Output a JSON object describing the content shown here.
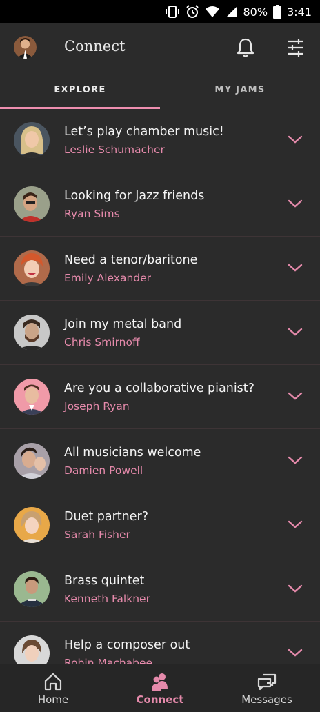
{
  "status": {
    "battery": "80%",
    "time": "3:41"
  },
  "header": {
    "title": "Connect"
  },
  "tabs": [
    {
      "label": "EXPLORE"
    },
    {
      "label": "MY JAMS"
    }
  ],
  "colors": {
    "accent": "#ee8fb0",
    "background": "#2b2b2b"
  },
  "jams": [
    {
      "title": "Let’s play chamber music!",
      "name": "Leslie Schumacher"
    },
    {
      "title": "Looking for Jazz friends",
      "name": "Ryan Sims"
    },
    {
      "title": "Need a tenor/baritone",
      "name": "Emily Alexander"
    },
    {
      "title": "Join my metal band",
      "name": "Chris Smirnoff"
    },
    {
      "title": "Are you a collaborative pianist?",
      "name": "Joseph Ryan"
    },
    {
      "title": "All musicians welcome",
      "name": "Damien Powell"
    },
    {
      "title": "Duet partner?",
      "name": "Sarah Fisher"
    },
    {
      "title": "Brass quintet",
      "name": "Kenneth Falkner"
    },
    {
      "title": "Help a composer out",
      "name": "Robin Machabee"
    }
  ],
  "nav": [
    {
      "label": "Home"
    },
    {
      "label": "Connect"
    },
    {
      "label": "Messages"
    }
  ]
}
